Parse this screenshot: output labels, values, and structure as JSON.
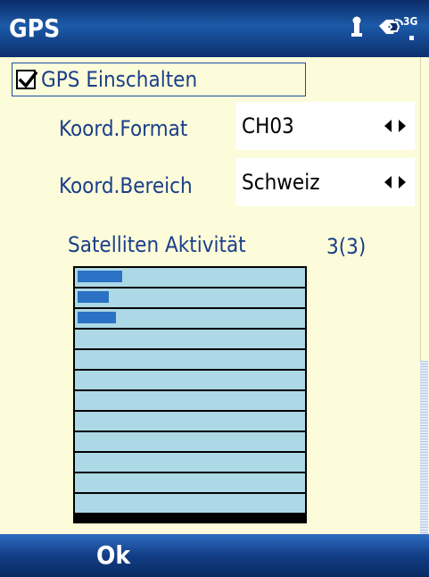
{
  "titlebar": {
    "title": "GPS",
    "icons": [
      "signal-strength-icon",
      "data-connection-3g-icon"
    ],
    "badge_3g": "3G"
  },
  "gps_toggle": {
    "label": "GPS Einschalten",
    "checked": true
  },
  "fields": [
    {
      "label": "Koord.Format",
      "value": "CH03"
    },
    {
      "label": "Koord.Bereich",
      "value": "Schweiz"
    }
  ],
  "satellites": {
    "label": "Satelliten Aktivität",
    "count": "3(3)",
    "rows": 12,
    "activity": [
      0.2,
      0.14,
      0.17,
      0,
      0,
      0,
      0,
      0,
      0,
      0,
      0,
      0
    ]
  },
  "softkeys": {
    "left": "Ok"
  },
  "colors": {
    "background": "#fcfcda",
    "label_text": "#1b3f8a",
    "bar_background": "#add8e6",
    "bar_fill": "#2b72c4",
    "titlebar": "#1c5aa8"
  }
}
